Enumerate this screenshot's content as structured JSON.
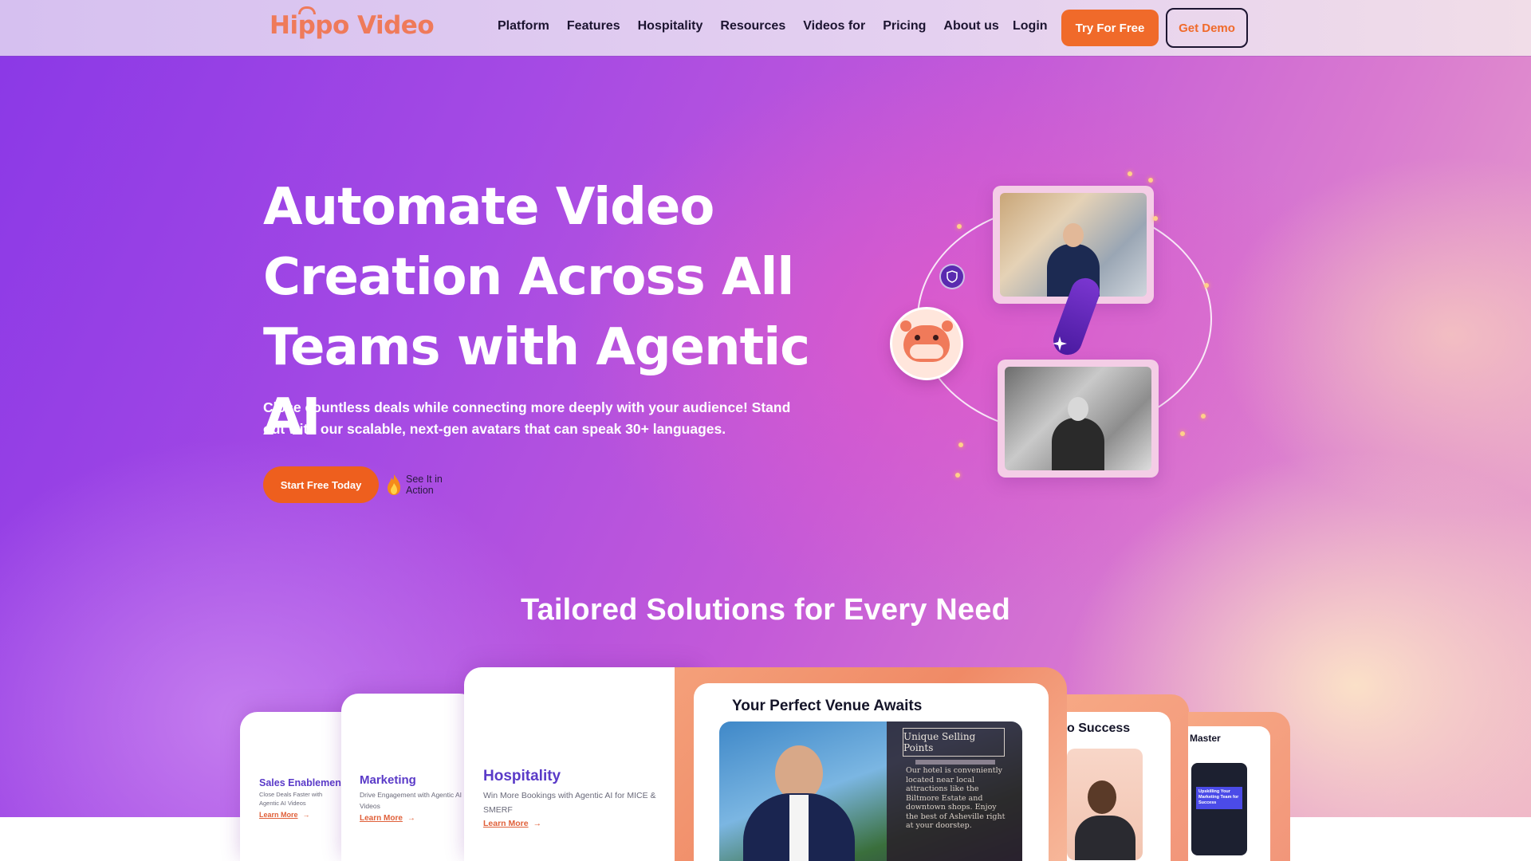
{
  "nav": {
    "logo": "Hippo Video",
    "links": [
      "Platform",
      "Features",
      "Hospitality",
      "Resources",
      "Videos for",
      "Pricing",
      "About us"
    ],
    "login": "Login",
    "try_free": "Try For Free",
    "get_demo": "Get Demo"
  },
  "hero": {
    "title_line1": "Automate Video",
    "title_line2": "Creation Across All",
    "title_line3": "Teams with Agentic AI",
    "subtitle": "Close countless deals while connecting more deeply with your audience! Stand out with our scalable, next-gen avatars that can speak 30+ languages.",
    "start_button": "Start Free Today",
    "see_action_line1": "See It in",
    "see_action_line2": "Action"
  },
  "solutions": {
    "title": "Tailored Solutions for Every Need",
    "cards": [
      {
        "label": "Sales Enablement",
        "desc": "Close Deals Faster with Agentic AI Videos",
        "link": "Learn More",
        "arrow": "→"
      },
      {
        "label": "Marketing",
        "desc": "Drive Engagement with Agentic AI Videos",
        "link": "Learn More",
        "arrow": "→"
      },
      {
        "label": "Hospitality",
        "desc": "Win More Bookings with Agentic AI for MICE & SMERF",
        "link": "Learn More",
        "arrow": "→"
      }
    ],
    "feature": {
      "title": "Your Perfect Venue Awaits",
      "usp_title": "Unique Selling Points",
      "usp_text": "Our hotel is conveniently located near local attractions like the Biltmore Estate and downtown shops. Enjoy the best of Asheville right at your doorstep."
    },
    "right_card_1": {
      "title": "o Success"
    },
    "right_card_2": {
      "title": "Master",
      "screen_title": "Upskilling Your Marketing Team for Success"
    }
  },
  "colors": {
    "brand_orange": "#f06a2a",
    "logo_coral": "#ef7a5a",
    "card_label_purple": "#5a3ac8"
  },
  "icons": [
    "hippo-logo-icon",
    "flame-icon",
    "shield-icon",
    "sparkle-icon",
    "hippo-badge-icon",
    "arrow-right-icon"
  ]
}
